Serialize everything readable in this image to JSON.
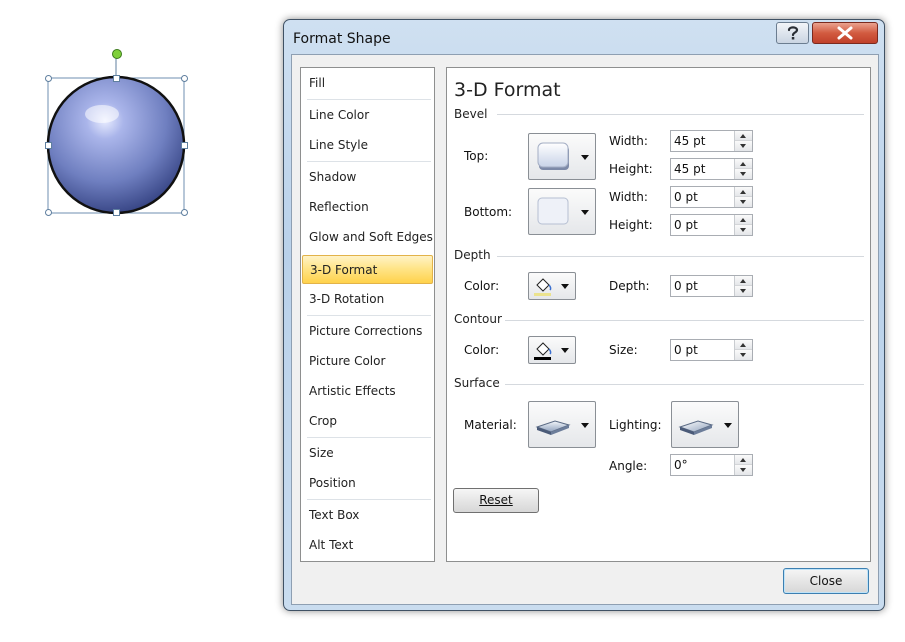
{
  "dialog": {
    "title": "Format Shape",
    "help_icon": "question-mark-icon",
    "close_icon": "x-icon",
    "close_button_label": "Close"
  },
  "categories": [
    {
      "label": "Fill"
    },
    {
      "label": "Line Color"
    },
    {
      "label": "Line Style"
    },
    {
      "label": "Shadow"
    },
    {
      "label": "Reflection"
    },
    {
      "label": "Glow and Soft Edges"
    },
    {
      "label": "3-D Format",
      "selected": true
    },
    {
      "label": "3-D Rotation"
    },
    {
      "label": "Picture Corrections"
    },
    {
      "label": "Picture Color"
    },
    {
      "label": "Artistic Effects"
    },
    {
      "label": "Crop"
    },
    {
      "label": "Size"
    },
    {
      "label": "Position"
    },
    {
      "label": "Text Box"
    },
    {
      "label": "Alt Text"
    }
  ],
  "panel": {
    "title": "3-D Format",
    "bevel": {
      "section": "Bevel",
      "top_label": "Top:",
      "bottom_label": "Bottom:",
      "width_label": "Width:",
      "height_label": "Height:",
      "top_width": "45 pt",
      "top_height": "45 pt",
      "bottom_width": "0 pt",
      "bottom_height": "0 pt"
    },
    "depth": {
      "section": "Depth",
      "color_label": "Color:",
      "depth_label": "Depth:",
      "depth_value": "0 pt"
    },
    "contour": {
      "section": "Contour",
      "color_label": "Color:",
      "size_label": "Size:",
      "size_value": "0 pt"
    },
    "surface": {
      "section": "Surface",
      "material_label": "Material:",
      "lighting_label": "Lighting:",
      "angle_label": "Angle:",
      "angle_value": "0°"
    },
    "reset_label": "Reset"
  },
  "colors": {
    "selected_category": "#ffd24c",
    "sphere": "#6f7fc0",
    "close_button": "#c0402a",
    "rotation_handle": "#7fd03a"
  }
}
